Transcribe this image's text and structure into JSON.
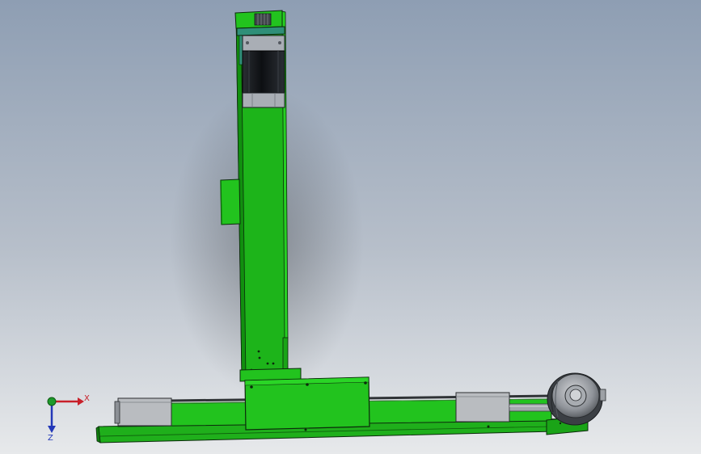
{
  "viewport": {
    "background_top": "#8f9fb4",
    "background_bottom": "#e6e8ea"
  },
  "colors": {
    "part_green": "#22c31e",
    "part_green_dark": "#0e6f0c",
    "part_green_shade": "#1aa417",
    "edge": "#0b2a0b",
    "motor_black": "#15181c",
    "motor_gray": "#9aa0a8",
    "bracket_gray": "#b4b7bb",
    "rail_dark": "#2f3336",
    "axis_x": "#c8202a",
    "axis_y": "#1d9a2a",
    "axis_z": "#2338b8"
  },
  "triad": {
    "x_label": "X",
    "z_label": "Z"
  },
  "icons": {
    "motor": "stepper-motor-icon",
    "triad": "axis-triad-icon",
    "handwheel": "handwheel-icon"
  }
}
